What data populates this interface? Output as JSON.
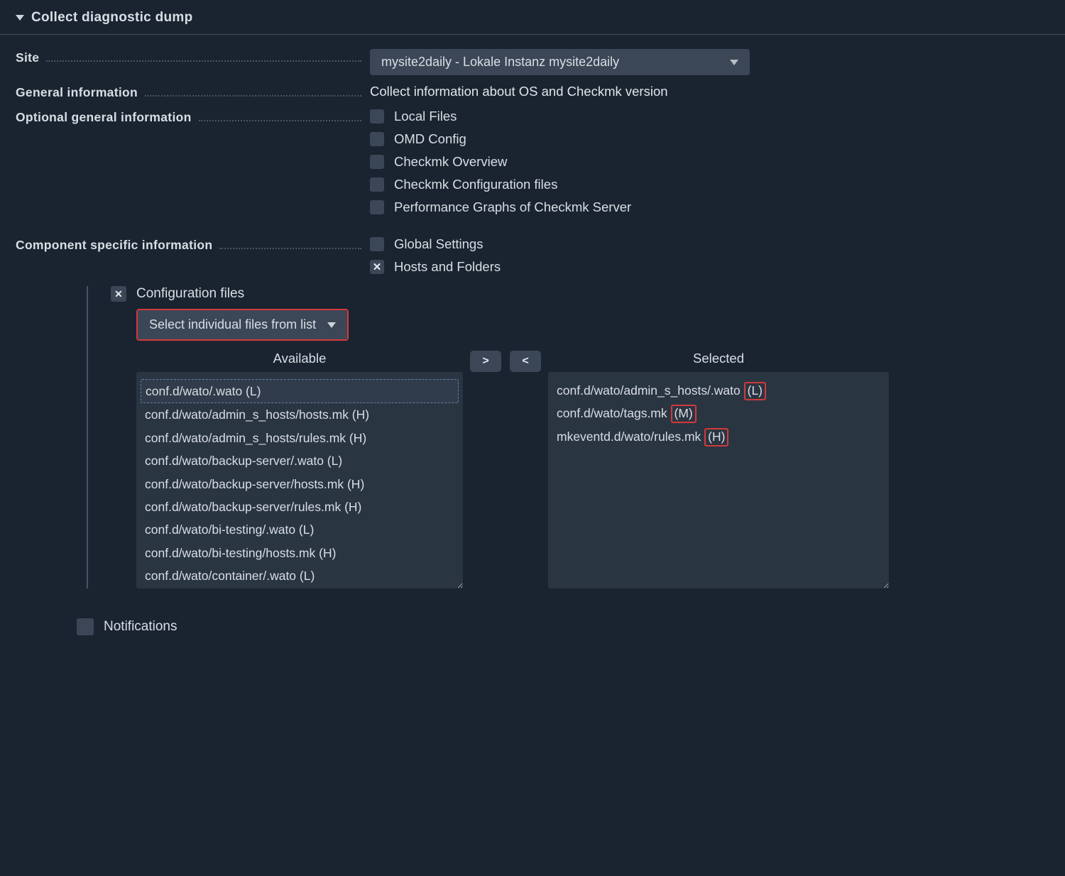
{
  "header": {
    "title": "Collect diagnostic dump"
  },
  "site": {
    "label": "Site",
    "selected": "mysite2daily - Lokale Instanz mysite2daily"
  },
  "general_info": {
    "label": "General information",
    "value": "Collect information about OS and Checkmk version"
  },
  "optional_info": {
    "label": "Optional general information",
    "options": [
      {
        "label": "Local Files"
      },
      {
        "label": "OMD Config"
      },
      {
        "label": "Checkmk Overview"
      },
      {
        "label": "Checkmk Configuration files"
      },
      {
        "label": "Performance Graphs of Checkmk Server"
      }
    ]
  },
  "component_info": {
    "label": "Component specific information",
    "rows": [
      {
        "label": "Global Settings",
        "checked": false
      },
      {
        "label": "Hosts and Folders",
        "checked": true
      }
    ]
  },
  "config_files": {
    "title": "Configuration files",
    "mode": "Select individual files from list",
    "available_title": "Available",
    "selected_title": "Selected",
    "move_right": ">",
    "move_left": "<",
    "available": [
      {
        "path": "conf.d/wato/.wato",
        "tag": "L",
        "selected": true
      },
      {
        "path": "conf.d/wato/admin_s_hosts/hosts.mk",
        "tag": "H"
      },
      {
        "path": "conf.d/wato/admin_s_hosts/rules.mk",
        "tag": "H"
      },
      {
        "path": "conf.d/wato/backup-server/.wato",
        "tag": "L"
      },
      {
        "path": "conf.d/wato/backup-server/hosts.mk",
        "tag": "H"
      },
      {
        "path": "conf.d/wato/backup-server/rules.mk",
        "tag": "H"
      },
      {
        "path": "conf.d/wato/bi-testing/.wato",
        "tag": "L"
      },
      {
        "path": "conf.d/wato/bi-testing/hosts.mk",
        "tag": "H"
      },
      {
        "path": "conf.d/wato/container/.wato",
        "tag": "L"
      }
    ],
    "selected": [
      {
        "path": "conf.d/wato/admin_s_hosts/.wato",
        "tag": "L",
        "hl": true
      },
      {
        "path": "conf.d/wato/tags.mk",
        "tag": "M",
        "hl": true
      },
      {
        "path": "mkeventd.d/wato/rules.mk",
        "tag": "H",
        "hl": true
      }
    ]
  },
  "notifications": {
    "label": "Notifications"
  }
}
